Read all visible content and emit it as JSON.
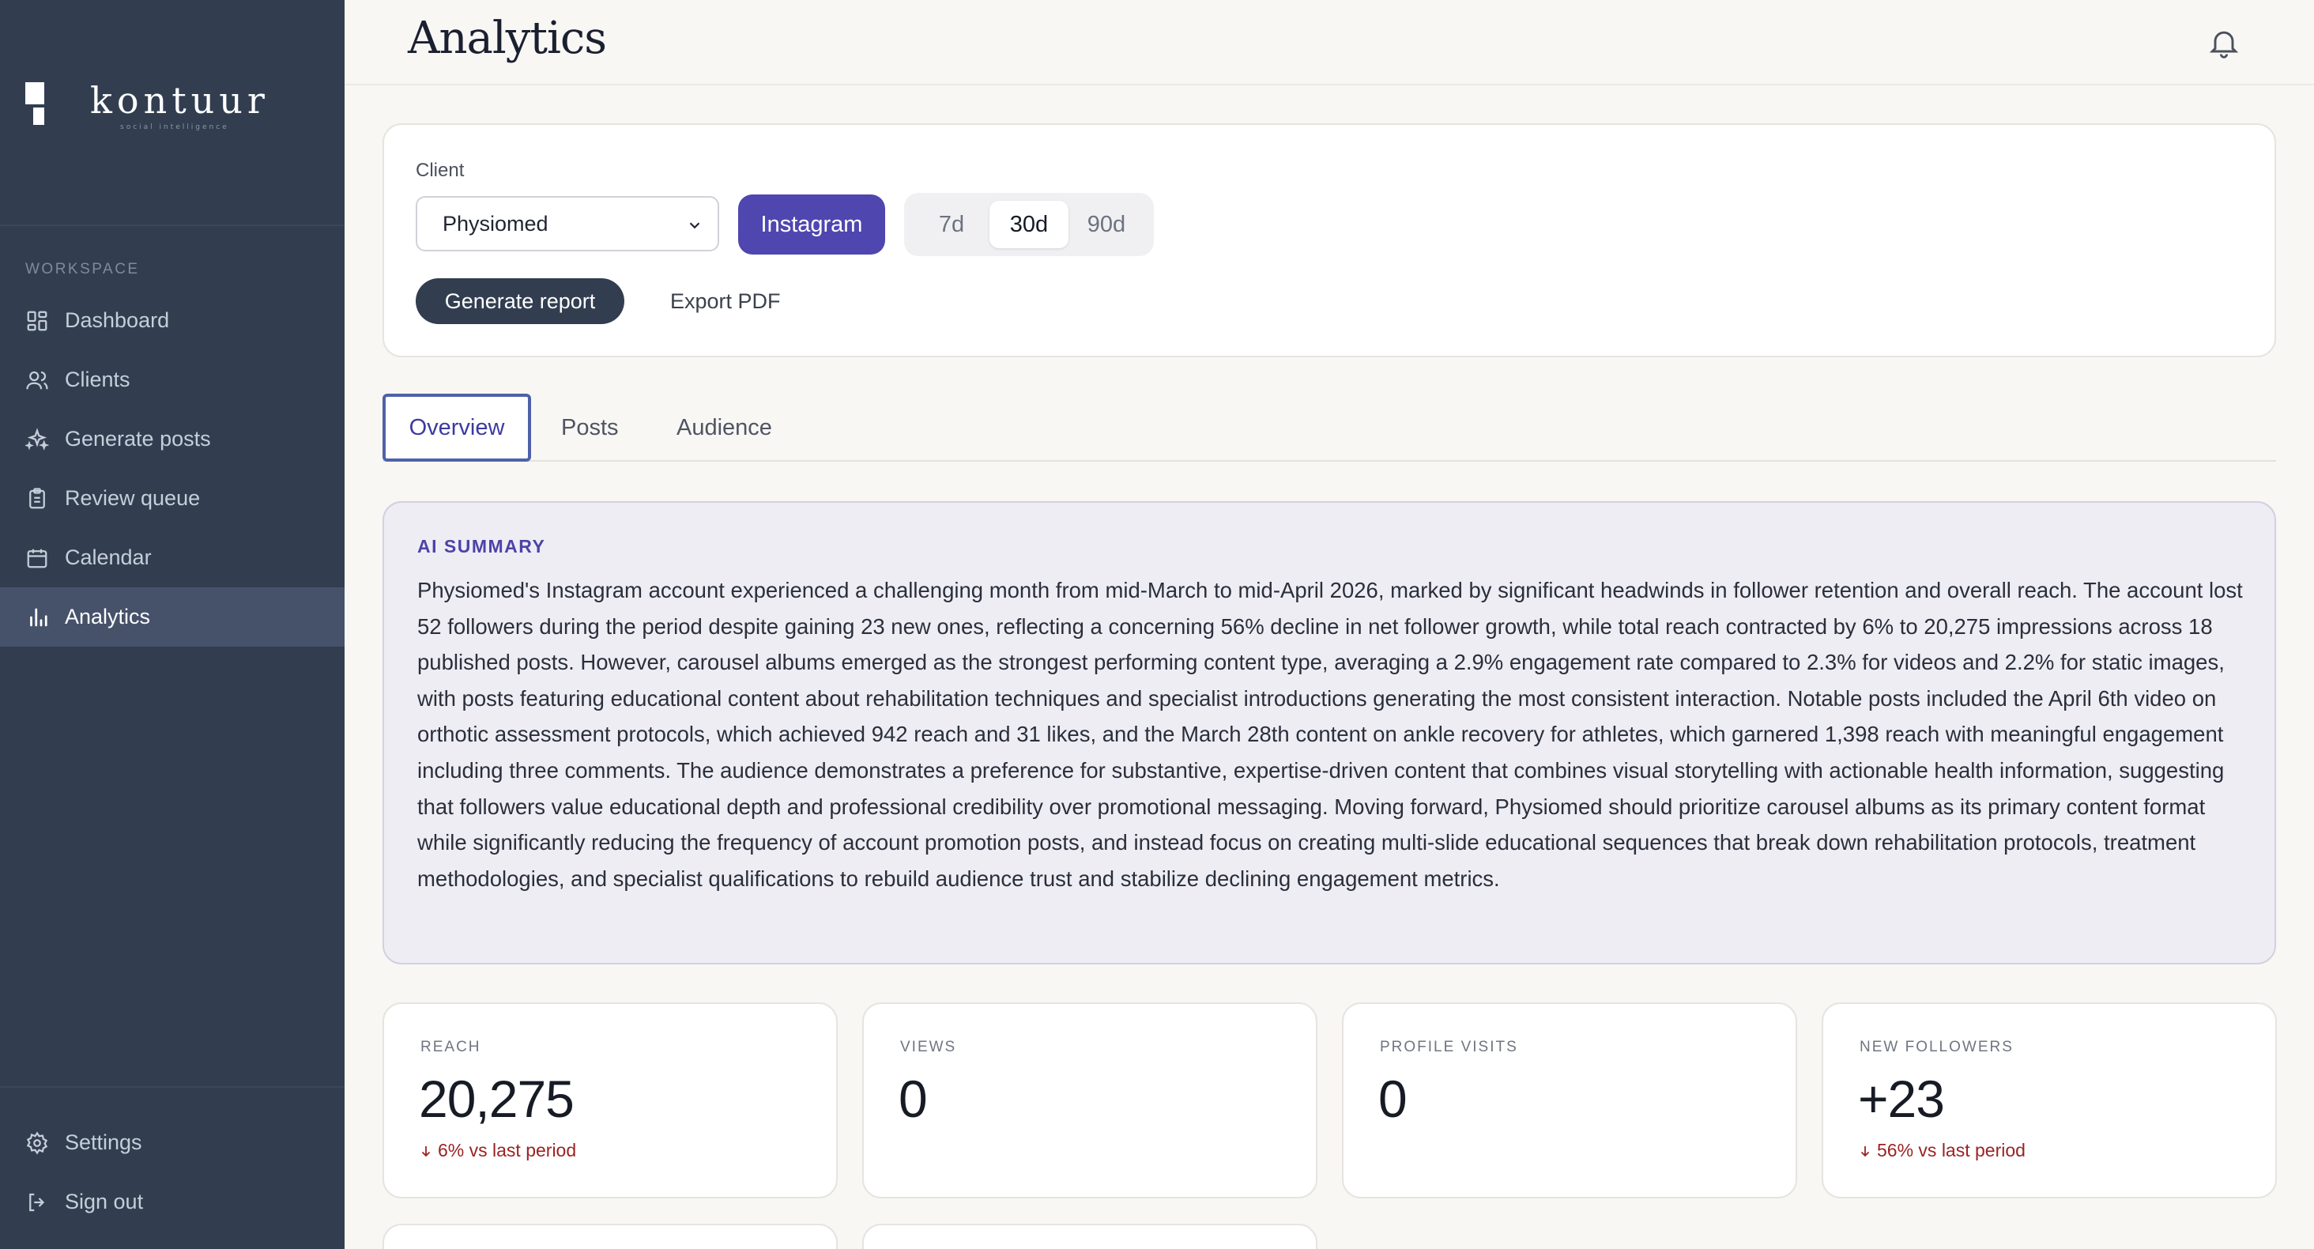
{
  "brand": {
    "name": "kontuur",
    "tagline": "social intelligence"
  },
  "sidebar": {
    "section_label": "WORKSPACE",
    "items": [
      {
        "label": "Dashboard",
        "icon": "dashboard-icon"
      },
      {
        "label": "Clients",
        "icon": "users-icon"
      },
      {
        "label": "Generate posts",
        "icon": "sparkle-icon"
      },
      {
        "label": "Review queue",
        "icon": "clipboard-icon"
      },
      {
        "label": "Calendar",
        "icon": "calendar-icon"
      },
      {
        "label": "Analytics",
        "icon": "bar-chart-icon",
        "active": true
      }
    ],
    "bottom": [
      {
        "label": "Settings",
        "icon": "gear-icon"
      },
      {
        "label": "Sign out",
        "icon": "sign-out-icon"
      }
    ]
  },
  "header": {
    "title": "Analytics",
    "icon": "bell-icon"
  },
  "controls": {
    "client_label": "Client",
    "client_value": "Physiomed",
    "platform": "Instagram",
    "ranges": [
      "7d",
      "30d",
      "90d"
    ],
    "selected_range": "30d",
    "generate_label": "Generate report",
    "export_label": "Export PDF"
  },
  "tabs": [
    "Overview",
    "Posts",
    "Audience"
  ],
  "active_tab": "Overview",
  "summary": {
    "label": "AI SUMMARY",
    "text": "Physiomed's Instagram account experienced a challenging month from mid-March to mid-April 2026, marked by significant headwinds in follower retention and overall reach. The account lost 52 followers during the period despite gaining 23 new ones, reflecting a concerning 56% decline in net follower growth, while total reach contracted by 6% to 20,275 impressions across 18 published posts. However, carousel albums emerged as the strongest performing content type, averaging a 2.9% engagement rate compared to 2.3% for videos and 2.2% for static images, with posts featuring educational content about rehabilitation techniques and specialist introductions generating the most consistent interaction. Notable posts included the April 6th video on orthotic assessment protocols, which achieved 942 reach and 31 likes, and the March 28th content on ankle recovery for athletes, which garnered 1,398 reach with meaningful engagement including three comments. The audience demonstrates a preference for substantive, expertise-driven content that combines visual storytelling with actionable health information, suggesting that followers value educational depth and professional credibility over promotional messaging. Moving forward, Physiomed should prioritize carousel albums as its primary content format while significantly reducing the frequency of account promotion posts, and instead focus on creating multi-slide educational sequences that break down rehabilitation protocols, treatment methodologies, and specialist qualifications to rebuild audience trust and stabilize declining engagement metrics."
  },
  "metrics": [
    {
      "label": "REACH",
      "value": "20,275",
      "delta": "6% vs last period",
      "trend": "down"
    },
    {
      "label": "VIEWS",
      "value": "0",
      "delta": "",
      "trend": "none"
    },
    {
      "label": "PROFILE VISITS",
      "value": "0",
      "delta": "",
      "trend": "none"
    },
    {
      "label": "NEW FOLLOWERS",
      "value": "+23",
      "delta": "56% vs last period",
      "trend": "down"
    }
  ],
  "colors": {
    "sidebar": "#323e50",
    "accent": "#4f46b0",
    "negative": "#9b2222"
  }
}
